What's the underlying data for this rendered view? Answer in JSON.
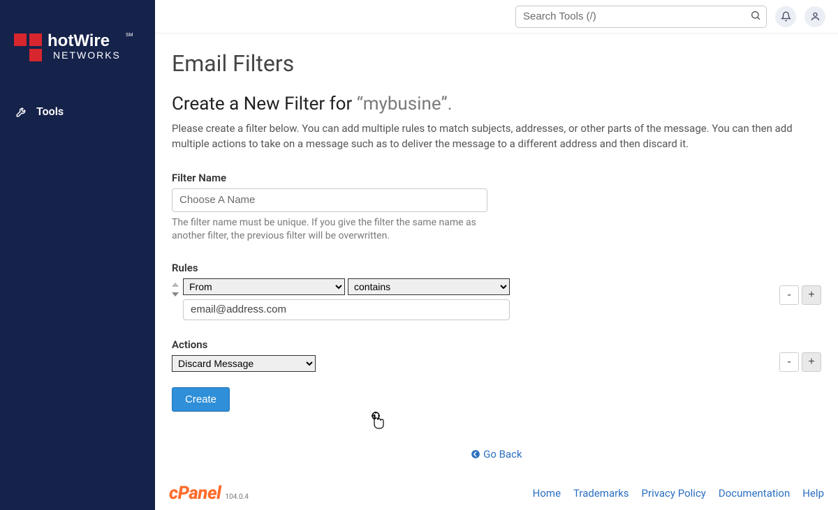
{
  "brand": {
    "name": "hotWire",
    "tag": "NETWORKS",
    "mark": "SM"
  },
  "sidebar": {
    "items": [
      {
        "label": "Tools"
      }
    ]
  },
  "header": {
    "search_placeholder": "Search Tools (/)"
  },
  "page": {
    "title": "Email Filters",
    "subtitle_pre": "Create a New Filter for ",
    "subtitle_quoted": "“mybusine”.",
    "help": "Please create a filter below. You can add multiple rules to match subjects, addresses, or other parts of the message. You can then add multiple actions to take on a message such as to deliver the message to a different address and then discard it."
  },
  "form": {
    "filter_name_label": "Filter Name",
    "filter_name_placeholder": "Choose A Name",
    "filter_name_hint": "The filter name must be unique. If you give the filter the same name as another filter, the previous filter will be overwritten.",
    "rules_label": "Rules",
    "rule_part": "From",
    "rule_match": "contains",
    "rule_value": "email@address.com",
    "actions_label": "Actions",
    "action_selected": "Discard Message",
    "minus": "-",
    "plus": "+",
    "create_label": "Create"
  },
  "goBack": {
    "label": "Go Back"
  },
  "footer": {
    "cpanel": "cPanel",
    "version": "104.0.4",
    "links": [
      {
        "label": "Home"
      },
      {
        "label": "Trademarks"
      },
      {
        "label": "Privacy Policy"
      },
      {
        "label": "Documentation"
      },
      {
        "label": "Help"
      }
    ]
  }
}
